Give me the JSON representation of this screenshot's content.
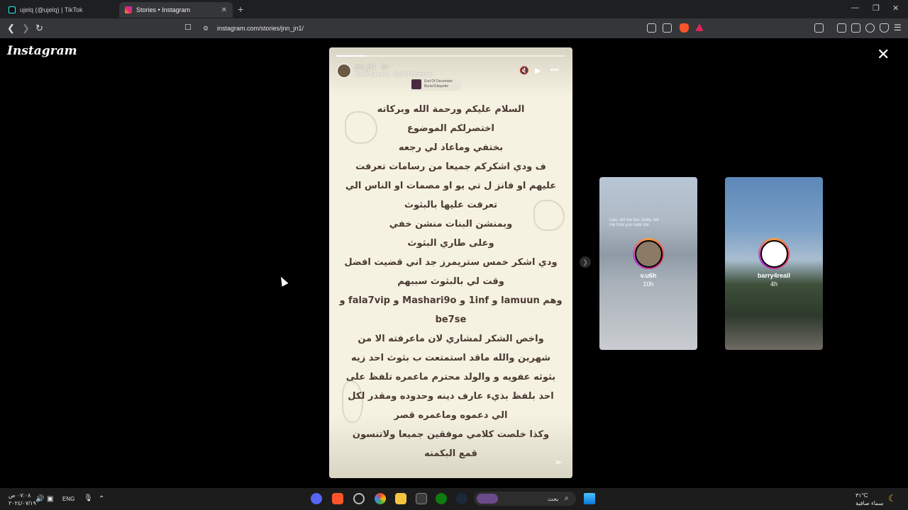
{
  "browser": {
    "tabs": [
      {
        "title": "ujelq (@ujelq) | TikTok",
        "active": false
      },
      {
        "title": "Stories • Instagram",
        "active": true
      }
    ],
    "url": "instagram.com/stories/jnn_jn1/"
  },
  "page": {
    "logo": "Instagram",
    "close_icon": "close-icon"
  },
  "story": {
    "username": "jnn_jn1",
    "time": "1h",
    "music": "Burial Etiquette · End Of December",
    "sticker_title": "End Of December",
    "sticker_artist": "Burial Etiquette",
    "progress": 0.13,
    "lines": [
      "السلام عليكم ورحمة الله وبركاته",
      "اختصرلكم الموضوع",
      "بختفي وماعاد لي رجعه",
      "ف ودي اشكركم جميعا من رسامات تعرفت",
      "عليهم او فانز ل تي يو او مصمات او الناس الي",
      "تعرفت عليها بالبثوث",
      "وبمنشن البنات منشن خفي",
      "وعلى طاري البثوث",
      "ودي اشكر خمس ستريمرز جد اني قضيت افضل",
      "وقت لي بالبثوث سببهم",
      "وهم lamuun و 1inf و Mashari9o و fala7vip و",
      "be7se",
      "واخص الشكر لمشاري لان ماعرفته الا من",
      "شهرين والله ماقد استمتعت ب بثوث احد زيه",
      "بثوثه عفويه و والولد محترم ماعمره تلفظ على",
      "احد بلفظ بذيء عارف دينه وحدوده ومقدر لكل",
      "الي دعموه وماعمره قصر",
      "وكذا خلصت كلامي موفقين جميعا ولاتنسون",
      "قمع البكمنه"
    ]
  },
  "next_stories": [
    {
      "username": "v.u6h",
      "time": "10h",
      "lyric": "Lies, tell me lies, baby, tell me how you hate me"
    },
    {
      "username": "barry4reall",
      "time": "4h"
    }
  ],
  "taskbar": {
    "time": "٠٧:٠٨ ص",
    "date": "٢٠٢٤/٠٧/١٩",
    "lang": "ENG",
    "search_placeholder": "بحث",
    "weather_temp": "٣١°C",
    "weather_desc": "سماء صافية"
  },
  "colors": {
    "story_bg": "#f6f2e2",
    "story_text": "#4b3a32",
    "ring": "#e0245e"
  }
}
